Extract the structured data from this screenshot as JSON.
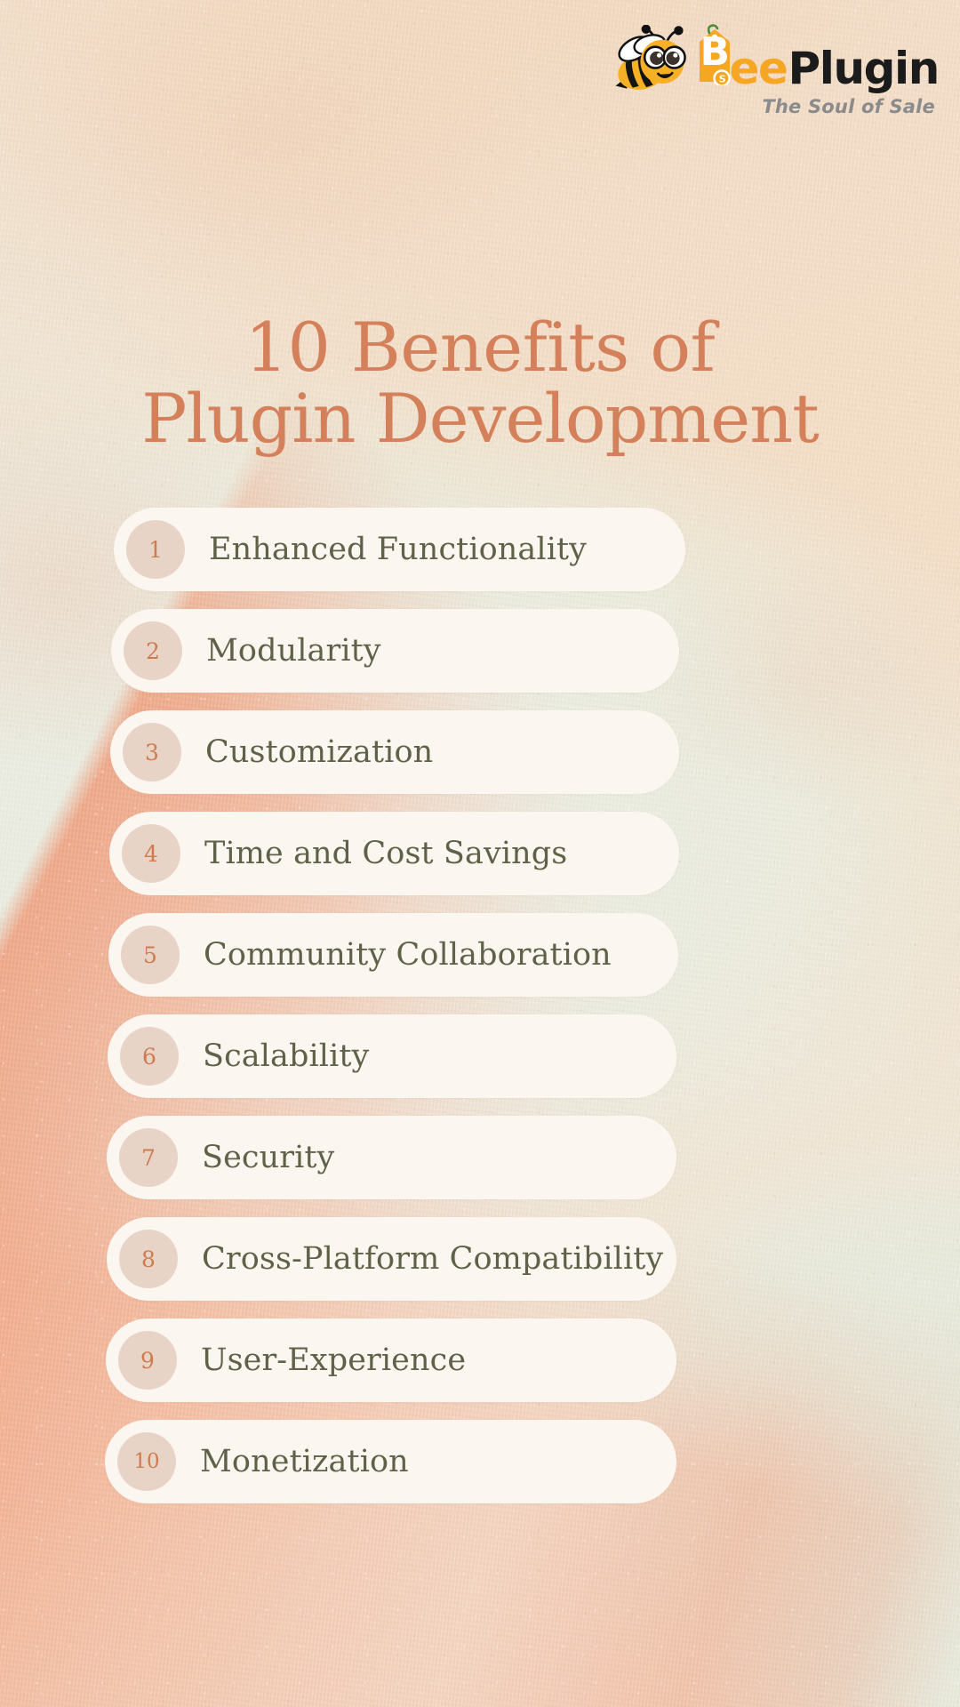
{
  "logo": {
    "bee_icon": "bee-mascot-icon",
    "tag_icon": "price-tag-icon",
    "brand_part_1": "B",
    "brand_part_2": "ee",
    "brand_part_3": "Plugin",
    "tagline": "The Soul of Sale",
    "colors": {
      "bee_yellow": "#f5a623",
      "brand_orange": "#f5a623",
      "brand_dark": "#1b1b1b",
      "tagline_gray": "#8b8b8b",
      "tag_green": "#4c8c3f"
    }
  },
  "title": {
    "line1": "10 Benefits of",
    "line2": "Plugin Development",
    "color": "#d4805a"
  },
  "benefits": [
    {
      "number": "1",
      "label": "Enhanced Functionality"
    },
    {
      "number": "2",
      "label": "Modularity"
    },
    {
      "number": "3",
      "label": "Customization"
    },
    {
      "number": "4",
      "label": "Time and Cost Savings"
    },
    {
      "number": "5",
      "label": "Community Collaboration"
    },
    {
      "number": "6",
      "label": "Scalability"
    },
    {
      "number": "7",
      "label": "Security"
    },
    {
      "number": "8",
      "label": "Cross-Platform Compatibility"
    },
    {
      "number": "9",
      "label": "User-Experience"
    },
    {
      "number": "10",
      "label": "Monetization"
    }
  ],
  "theme": {
    "pill_background": "#fcf6f1",
    "badge_background": "#e8d3c7",
    "badge_number_color": "#ce7c4f",
    "label_color": "#5f6249",
    "background_peach": "#f3ddc6",
    "background_sage": "#eceee3",
    "background_coral": "#f0a073"
  }
}
